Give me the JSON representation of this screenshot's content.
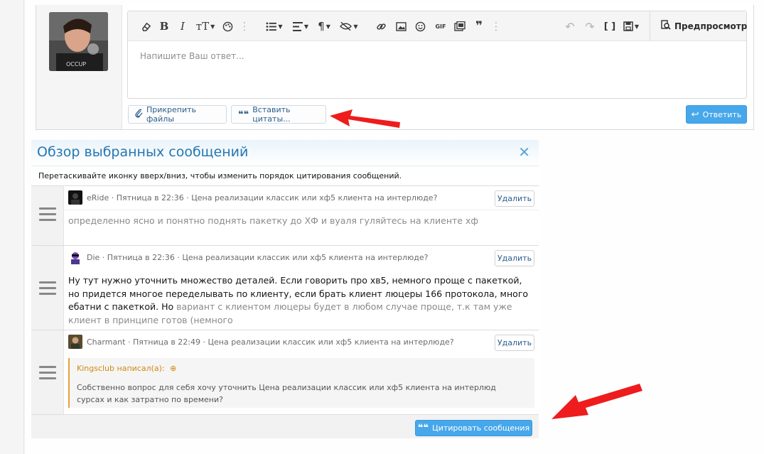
{
  "editor": {
    "placeholder": "Напишите Ваш ответ...",
    "preview_label": "Предпросмотр",
    "toolbar": [
      {
        "icon": "eraser-icon",
        "glyph": "⌫"
      },
      {
        "icon": "bold-icon",
        "glyph": "B"
      },
      {
        "icon": "italic-icon",
        "glyph": "I"
      },
      {
        "icon": "text-size-icon",
        "glyph": "тТ"
      },
      {
        "icon": "palette-icon",
        "glyph": "◕"
      },
      {
        "icon": "more-icon",
        "glyph": "⋮"
      },
      {
        "icon": "list-icon",
        "glyph": "☰"
      },
      {
        "icon": "align-icon",
        "glyph": "≡"
      },
      {
        "icon": "paragraph-icon",
        "glyph": "¶"
      },
      {
        "icon": "hide-icon",
        "glyph": "⊘"
      },
      {
        "icon": "link-icon",
        "glyph": "⛓"
      },
      {
        "icon": "image-icon",
        "glyph": "▣"
      },
      {
        "icon": "smile-icon",
        "glyph": "☺"
      },
      {
        "icon": "gif-icon",
        "glyph": "GIF"
      },
      {
        "icon": "media-icon",
        "glyph": "▤"
      },
      {
        "icon": "quote-icon",
        "glyph": "❞"
      },
      {
        "icon": "more-icon",
        "glyph": "⋮"
      },
      {
        "icon": "undo-icon",
        "glyph": "↶"
      },
      {
        "icon": "redo-icon",
        "glyph": "↷"
      },
      {
        "icon": "bbcode-icon",
        "glyph": "[ ]"
      },
      {
        "icon": "save-draft-icon",
        "glyph": "▦"
      }
    ]
  },
  "actions": {
    "attach_label": "Прикрепить файлы",
    "insert_quotes_label": "Вставить цитаты...",
    "reply_label": "Ответить"
  },
  "overlay": {
    "title": "Обзор выбранных сообщений",
    "hint": "Перетаскивайте иконку вверх/вниз, чтобы изменить порядок цитирования сообщений.",
    "delete_label": "Удалить",
    "cite_label": "Цитировать сообщения",
    "messages": [
      {
        "meta": "eRide · Пятница в 22:36 · Цена реализации классик или хф5 клиента на интерлюде?",
        "text": "определенно ясно и понятно поднять пакетку до ХФ и вуаля гуляйтесь на клиенте хф"
      },
      {
        "meta": "Die · Пятница в 22:36 · Цена реализации классик или хф5 клиента на интерлюде?",
        "text": "Ну тут нужно уточнить множество деталей. Если говорить про хв5, немного проще с пакеткой, но придется многое переделывать по клиенту, если брать клиент люцеры 166 протокола, много ебатни с пакеткой. Но",
        "text_faded": "вариант с клиентом люцеры будет в любом случае проще, т.к там уже клиент в принципе готов (немного"
      },
      {
        "meta": "Charmant · Пятница в 22:49 · Цена реализации классик или хф5 клиента на интерлюде?",
        "quote_author": "Kingsclub написал(а):",
        "quote_text": "Собственно вопрос для себя хочу уточнить Цена реализации классик или хф5 клиента на интерлюд сурсах и как затратно по времени?"
      }
    ]
  }
}
